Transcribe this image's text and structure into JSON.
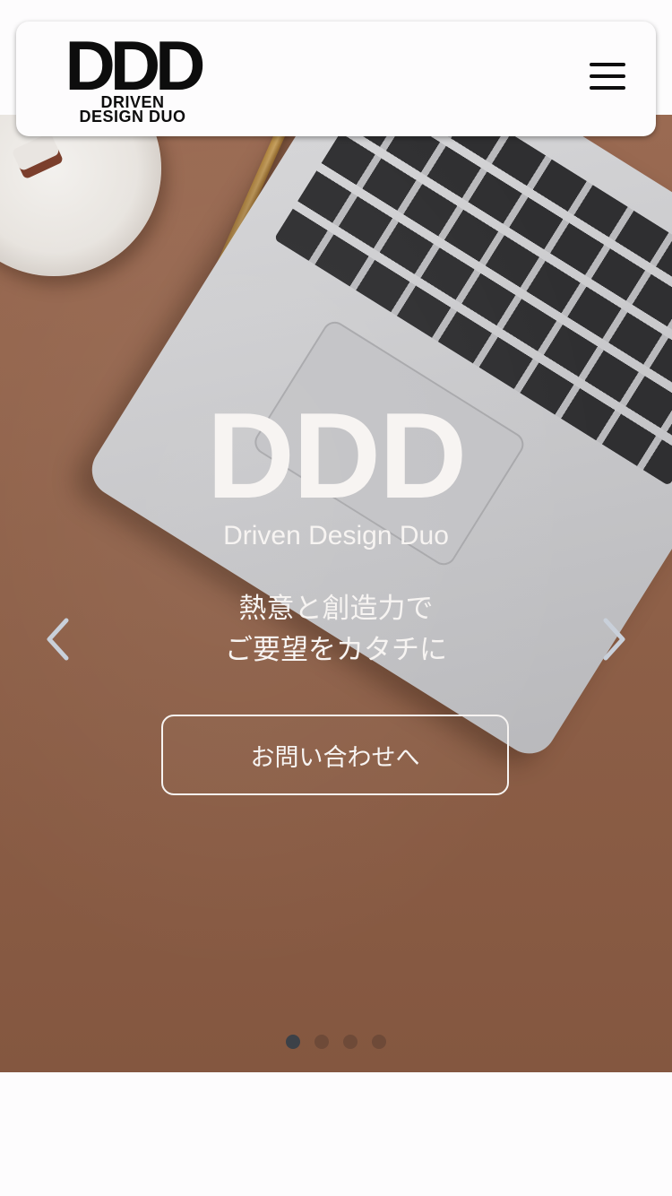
{
  "header": {
    "logo_mark": "DDD",
    "logo_line1": "DRIVEN",
    "logo_line2": "DESIGN DUO",
    "menu_icon": "hamburger-menu-icon"
  },
  "hero": {
    "title": "DDD",
    "subtitle": "Driven Design Duo",
    "tagline_line1": "熱意と創造力で",
    "tagline_line2": "ご要望をカタチに",
    "cta_label": "お問い合わせへ",
    "prev_icon": "chevron-left-icon",
    "next_icon": "chevron-right-icon",
    "slide_count": 4,
    "active_slide": 1
  },
  "colors": {
    "hero_text": "#f7f4f2",
    "arrow": "#c9d0da",
    "dot_active": "#3c4148",
    "dot_inactive": "#6e4a38",
    "logo": "#0d0d0d"
  }
}
